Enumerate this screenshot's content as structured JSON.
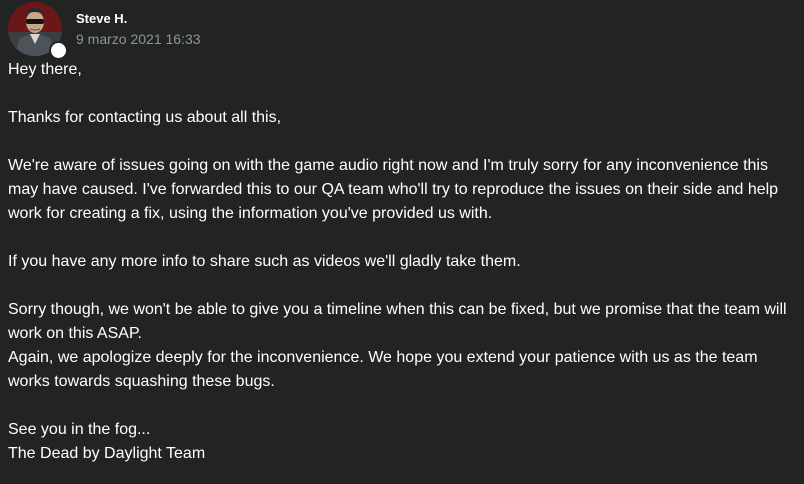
{
  "author": {
    "name": "Steve H.",
    "timestamp": "9 marzo 2021 16:33"
  },
  "message": {
    "lines": [
      "Hey there,",
      "Thanks for contacting us about all this,",
      "We're aware of issues going on with the game audio right now and I'm truly sorry for any inconvenience this",
      "may have caused. I've forwarded this to our QA team who'll try to reproduce the issues on their side and help",
      "work for creating a fix, using the information you've provided us with.",
      "If you have any more info to share such as videos we'll gladly take them.",
      "Sorry though, we won't be able to give you a timeline when this can be fixed, but we promise that the team will",
      "work on this ASAP.",
      "Again, we apologize deeply for the inconvenience. We hope you extend your patience with us as the team",
      "works towards squashing these bugs.",
      "See you in the fog...",
      "The Dead by Daylight Team"
    ]
  },
  "colors": {
    "background": "#222424",
    "text": "#ffffff",
    "timestamp": "#8f9394",
    "status_dot": "#ffffff"
  }
}
